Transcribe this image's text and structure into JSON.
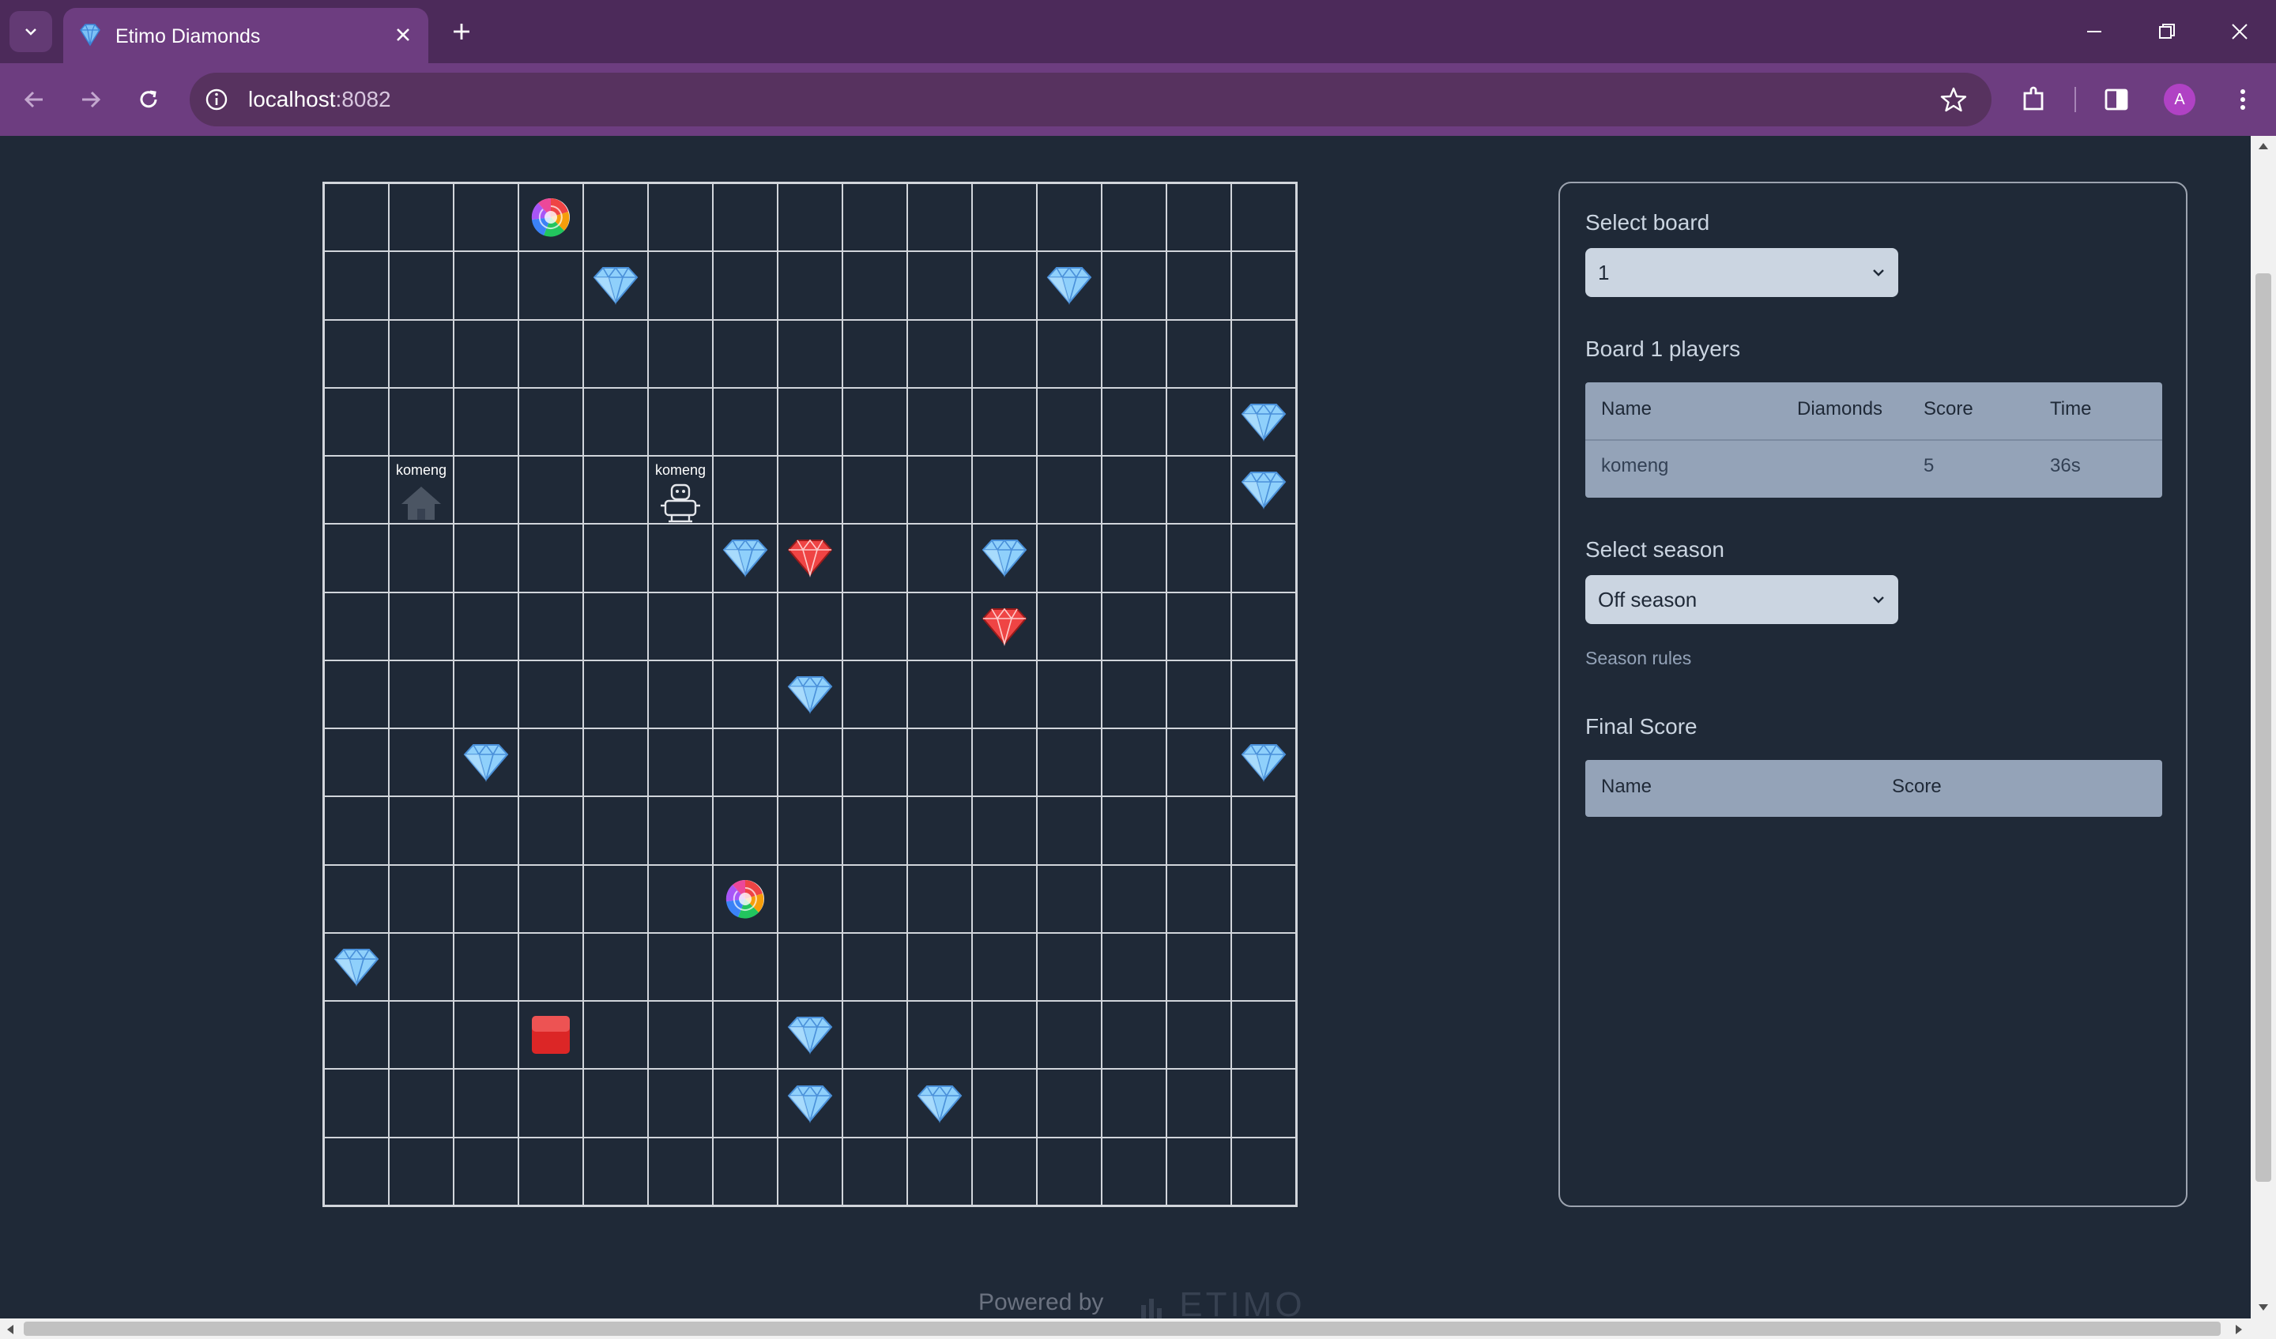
{
  "browser": {
    "tab_title": "Etimo Diamonds",
    "url_host": "localhost",
    "url_port": ":8082"
  },
  "board": {
    "rows": 15,
    "cols": 15,
    "items": [
      {
        "type": "teleporter",
        "row": 0,
        "col": 3
      },
      {
        "type": "diamond-blue",
        "row": 1,
        "col": 4
      },
      {
        "type": "diamond-blue",
        "row": 1,
        "col": 11
      },
      {
        "type": "diamond-blue",
        "row": 3,
        "col": 14
      },
      {
        "type": "base",
        "row": 4,
        "col": 1,
        "label": "komeng"
      },
      {
        "type": "bot",
        "row": 4,
        "col": 5,
        "label": "komeng"
      },
      {
        "type": "diamond-blue",
        "row": 4,
        "col": 14
      },
      {
        "type": "diamond-blue",
        "row": 5,
        "col": 6
      },
      {
        "type": "diamond-red",
        "row": 5,
        "col": 7
      },
      {
        "type": "diamond-blue",
        "row": 5,
        "col": 10
      },
      {
        "type": "diamond-red",
        "row": 6,
        "col": 10
      },
      {
        "type": "diamond-blue",
        "row": 7,
        "col": 7
      },
      {
        "type": "diamond-blue",
        "row": 8,
        "col": 2
      },
      {
        "type": "diamond-blue",
        "row": 8,
        "col": 14
      },
      {
        "type": "teleporter",
        "row": 10,
        "col": 6
      },
      {
        "type": "diamond-blue",
        "row": 11,
        "col": 0
      },
      {
        "type": "red-button",
        "row": 12,
        "col": 3
      },
      {
        "type": "diamond-blue",
        "row": 12,
        "col": 7
      },
      {
        "type": "diamond-blue",
        "row": 13,
        "col": 7
      },
      {
        "type": "diamond-blue",
        "row": 13,
        "col": 9
      }
    ]
  },
  "panel": {
    "select_board_label": "Select board",
    "select_board_value": "1",
    "players_heading": "Board 1 players",
    "players_columns": [
      "Name",
      "Diamonds",
      "Score",
      "Time"
    ],
    "players_rows": [
      {
        "name": "komeng",
        "diamonds": "",
        "score": "5",
        "time": "36s"
      }
    ],
    "select_season_label": "Select season",
    "select_season_value": "Off season",
    "season_rules": "Season rules",
    "final_score_heading": "Final Score",
    "final_columns": [
      "Name",
      "Score"
    ]
  },
  "footer": {
    "powered_by": "Powered by",
    "logo": "ETIMO"
  }
}
